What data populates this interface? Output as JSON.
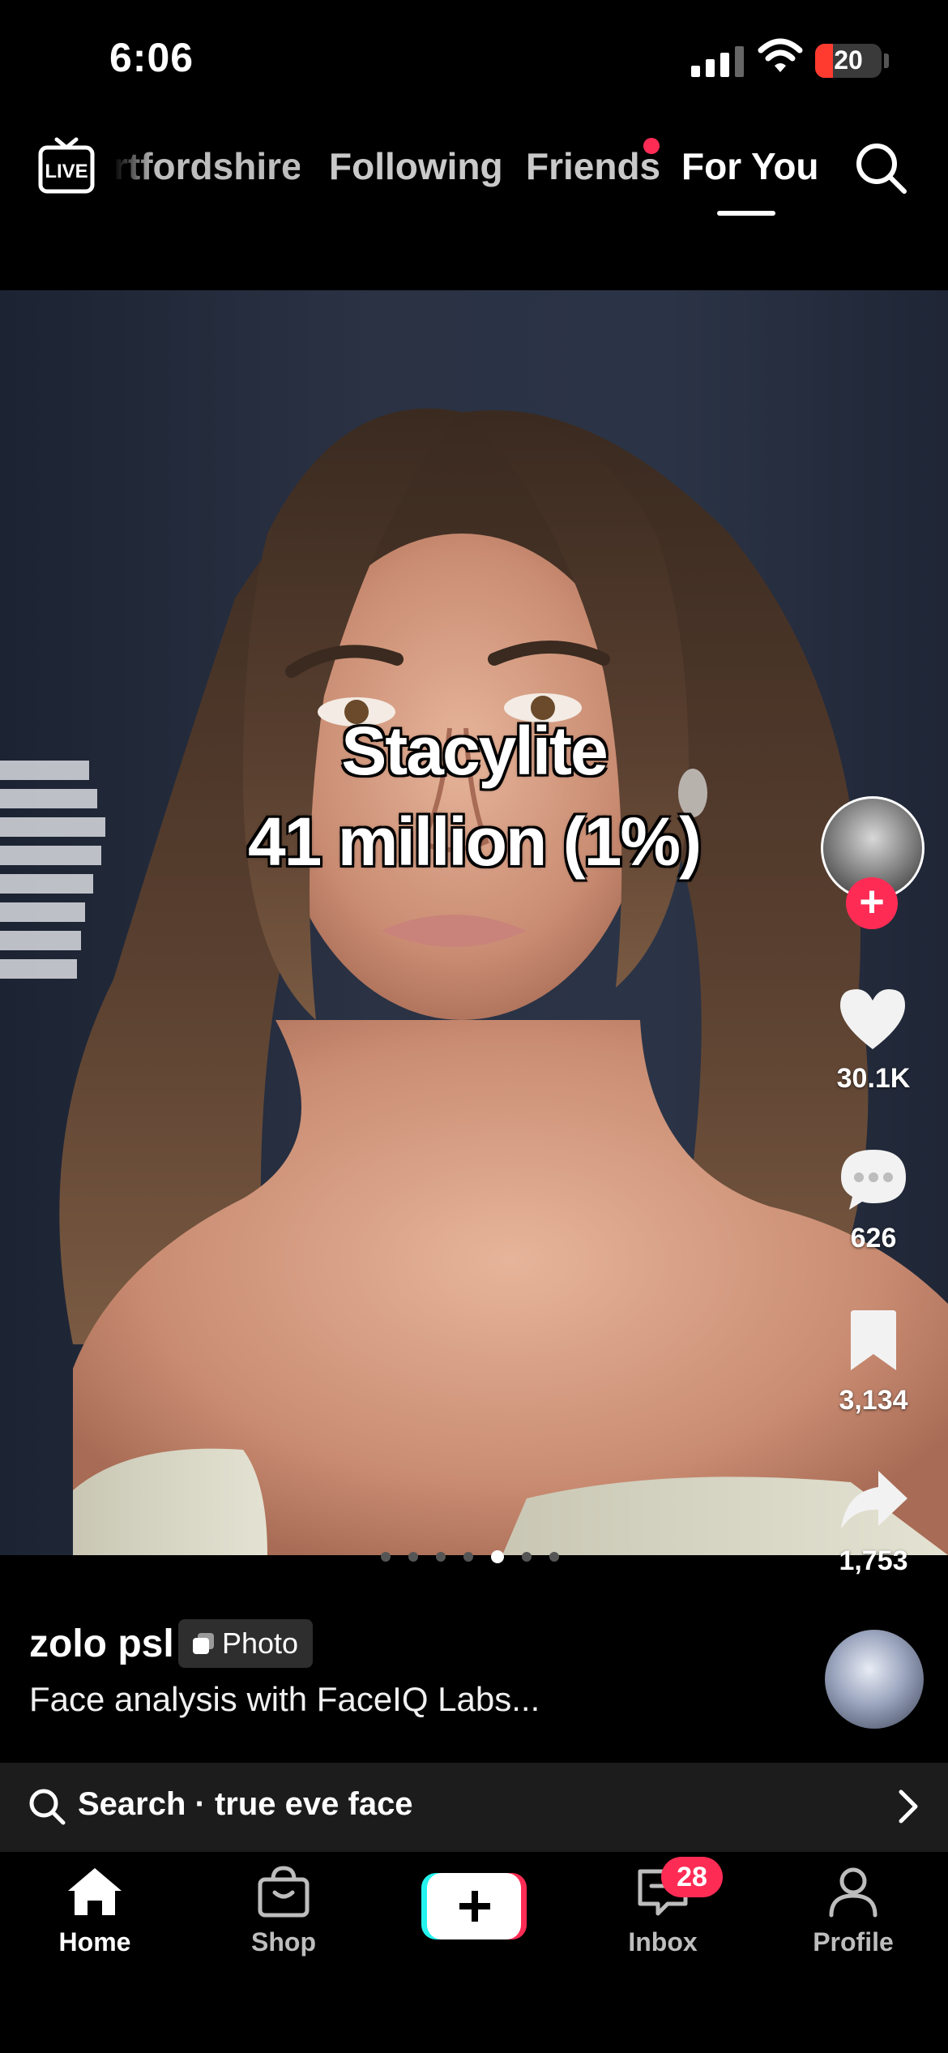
{
  "status_bar": {
    "time": "6:06",
    "battery": "20"
  },
  "top_nav": {
    "live_label": "LIVE",
    "tabs": [
      {
        "label": "rtfordshire"
      },
      {
        "label": "Following"
      },
      {
        "label": "Friends"
      },
      {
        "label": "For You"
      }
    ],
    "active_tab": "For You"
  },
  "post": {
    "overlay_line1": "Stacylite",
    "overlay_line2": "41 million (1%)",
    "likes": "30.1K",
    "comments": "626",
    "saves": "3,134",
    "shares": "1,753",
    "carousel": {
      "count": 7,
      "active_index": 4
    },
    "username": "zolo psl",
    "badge": "Photo",
    "description": "Face analysis with FaceIQ Labs..."
  },
  "search_suggestion": {
    "label": "Search · true eve face"
  },
  "bottom_nav": {
    "items": [
      {
        "label": "Home"
      },
      {
        "label": "Shop"
      },
      {
        "label": "Inbox"
      },
      {
        "label": "Profile"
      }
    ],
    "inbox_badge": "28"
  },
  "colors": {
    "accent": "#fe2c55",
    "cyan": "#25f4ee",
    "background": "#000000"
  }
}
